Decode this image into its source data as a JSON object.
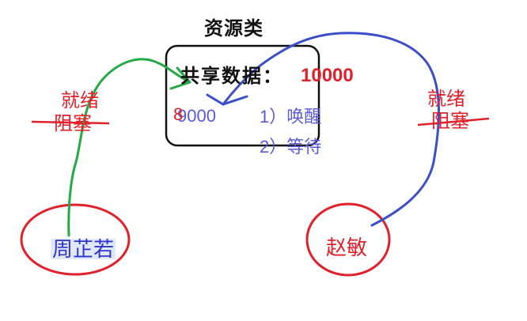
{
  "resource_class": {
    "title": "资源类",
    "shared_data_label": "共享数据：",
    "shared_data_value": "10000",
    "previous_value": "9000",
    "overwrite_digit": "8"
  },
  "steps": [
    {
      "label": "1）唤醒"
    },
    {
      "label": "2）等待"
    }
  ],
  "threads": [
    {
      "name": "周芷若",
      "state_ready": "就绪",
      "state_blocked": "阻塞",
      "arrow_color": "#22aa44"
    },
    {
      "name": "赵敏",
      "state_ready": "就绪",
      "state_blocked": "阻塞",
      "arrow_color": "#3b4fc8"
    }
  ],
  "colors": {
    "red": "#e0202a",
    "blue": "#3b4fc8",
    "green": "#22aa44",
    "box": "#111111"
  }
}
